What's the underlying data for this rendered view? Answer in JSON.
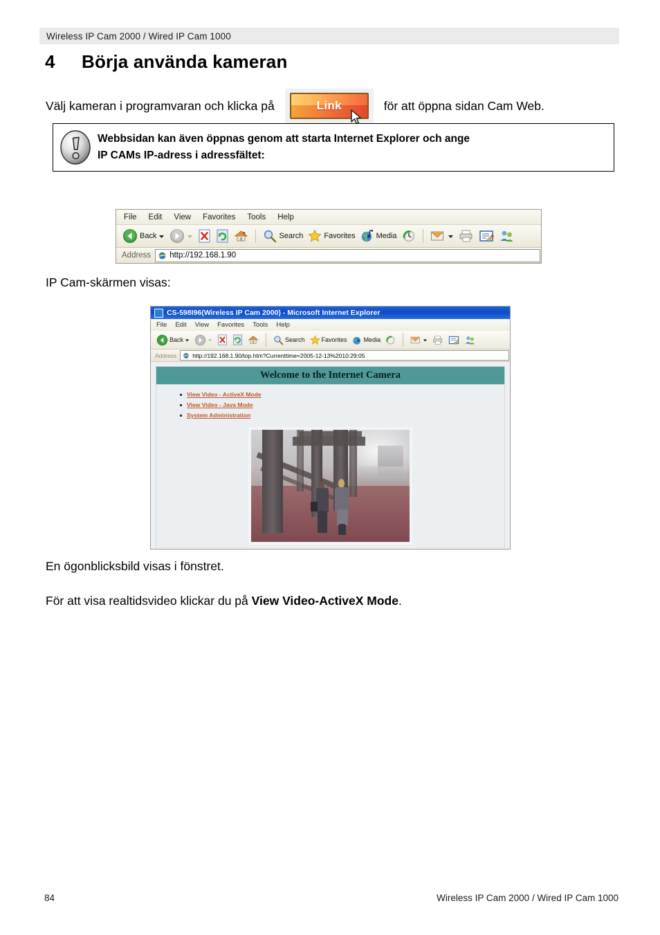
{
  "header": {
    "running_title": "Wireless IP Cam 2000 / Wired IP Cam 1000"
  },
  "chapter": {
    "number": "4",
    "title": "Börja använda kameran"
  },
  "intro": {
    "before_button": "Välj kameran i programvaran och klicka på",
    "button_label": "Link",
    "after_button": "för att öppna sidan Cam Web."
  },
  "note": {
    "icon": "exclamation-circle-icon",
    "line1": "Webbsidan kan även öppnas genom att starta Internet Explorer och ange",
    "line2": "IP CAMs IP-adress i adressfältet:"
  },
  "browser_bar": {
    "menu": [
      "File",
      "Edit",
      "View",
      "Favorites",
      "Tools",
      "Help"
    ],
    "buttons": [
      {
        "name": "back-button",
        "label": "Back",
        "icon": "back-arrow-icon"
      },
      {
        "name": "forward-button",
        "label": "",
        "icon": "forward-arrow-icon"
      },
      {
        "name": "stop-button",
        "label": "",
        "icon": "stop-icon"
      },
      {
        "name": "refresh-button",
        "label": "",
        "icon": "refresh-icon"
      },
      {
        "name": "home-button",
        "label": "",
        "icon": "home-icon"
      },
      {
        "name": "search-button",
        "label": "Search",
        "icon": "search-icon"
      },
      {
        "name": "favorites-button",
        "label": "Favorites",
        "icon": "star-icon"
      },
      {
        "name": "media-button",
        "label": "Media",
        "icon": "media-globe-icon"
      },
      {
        "name": "history-button",
        "label": "",
        "icon": "history-icon"
      },
      {
        "name": "mail-button",
        "label": "",
        "icon": "mail-icon"
      },
      {
        "name": "print-button",
        "label": "",
        "icon": "printer-icon"
      },
      {
        "name": "edit-button",
        "label": "",
        "icon": "edit-page-icon"
      },
      {
        "name": "messenger-button",
        "label": "",
        "icon": "messenger-icon"
      }
    ],
    "address_label": "Address",
    "address_value": "http://192.168.1.90"
  },
  "caption_ipcam": "IP Cam-skärmen visas:",
  "ie_window": {
    "title": "CS-598I96(Wireless IP Cam 2000) - Microsoft Internet Explorer",
    "menu": [
      "File",
      "Edit",
      "View",
      "Favorites",
      "Tools",
      "Help"
    ],
    "buttons": [
      {
        "name": "back-button",
        "label": "Back",
        "icon": "back-arrow-icon"
      },
      {
        "name": "forward-button",
        "label": "",
        "icon": "forward-arrow-icon"
      },
      {
        "name": "stop-button",
        "label": "",
        "icon": "stop-icon"
      },
      {
        "name": "refresh-button",
        "label": "",
        "icon": "refresh-icon"
      },
      {
        "name": "home-button",
        "label": "",
        "icon": "home-icon"
      },
      {
        "name": "search-button",
        "label": "Search",
        "icon": "search-icon"
      },
      {
        "name": "favorites-button",
        "label": "Favorites",
        "icon": "star-icon"
      },
      {
        "name": "media-button",
        "label": "Media",
        "icon": "media-globe-icon"
      },
      {
        "name": "history-button",
        "label": "",
        "icon": "history-icon"
      },
      {
        "name": "mail-button",
        "label": "",
        "icon": "mail-icon"
      },
      {
        "name": "print-button",
        "label": "",
        "icon": "printer-icon"
      },
      {
        "name": "edit-button",
        "label": "",
        "icon": "edit-page-icon"
      },
      {
        "name": "messenger-button",
        "label": "",
        "icon": "messenger-icon"
      }
    ],
    "address_label": "Address",
    "address_value": "http://192.168.1.90/top.htm?Currenttime=2005-12-13%2010:29:05",
    "page": {
      "banner": "Welcome to the Internet Camera",
      "banner_color": "#4F9A98",
      "link_color": "#C1562A",
      "links": [
        "View Video - ActiveX Mode",
        "View Video - Java Mode",
        "System Administration"
      ],
      "photo_alt": "snapshot-two-people-walking-under-steel-structure"
    }
  },
  "paragraphs": {
    "snapshot": "En ögonblicksbild visas i fönstret.",
    "realtime_before": "För att visa realtidsvideo klickar du på ",
    "realtime_bold": "View Video-ActiveX Mode",
    "realtime_after": "."
  },
  "footer": {
    "page_number": "84",
    "title": "Wireless IP Cam 2000 / Wired IP Cam 1000"
  }
}
